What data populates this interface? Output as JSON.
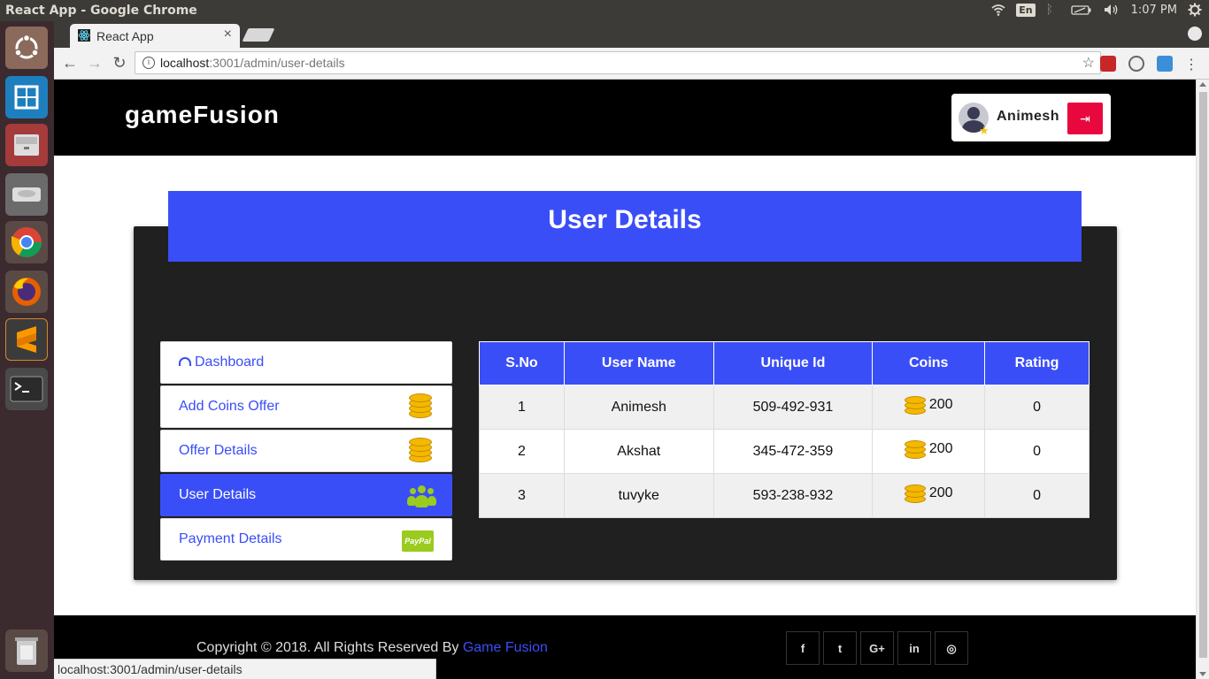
{
  "os": {
    "window_title": "React App - Google Chrome",
    "lang": "En",
    "clock": "1:07 PM"
  },
  "browser": {
    "tab_title": "React App",
    "tab_close": "×",
    "url_host": "localhost",
    "url_rest": ":3001/admin/user-details",
    "back": "←",
    "forward": "→",
    "reload": "↻",
    "star": "☆",
    "menu": "⋮",
    "info": "i",
    "status_url": "localhost:3001/admin/user-details"
  },
  "site": {
    "brand": "gameFusion",
    "user_name": "Animesh",
    "logout_icon": "⇥",
    "page_title": "User Details"
  },
  "sidebar": {
    "items": [
      {
        "label": "Dashboard",
        "icon": "dashboard-icon"
      },
      {
        "label": "Add Coins Offer",
        "icon": "coins-icon"
      },
      {
        "label": "Offer Details",
        "icon": "coins-icon"
      },
      {
        "label": "User Details",
        "icon": "users-icon"
      },
      {
        "label": "Payment Details",
        "icon": "paypal-icon"
      }
    ],
    "paypal_text": "PayPal"
  },
  "table": {
    "headers": [
      "S.No",
      "User Name",
      "Unique Id",
      "Coins",
      "Rating"
    ],
    "rows": [
      [
        "1",
        "Animesh",
        "509-492-931",
        "200",
        "0"
      ],
      [
        "2",
        "Akshat",
        "345-472-359",
        "200",
        "0"
      ],
      [
        "3",
        "tuvyke",
        "593-238-932",
        "200",
        "0"
      ]
    ]
  },
  "footer": {
    "copyright": "Copyright © 2018. All Rights Reserved By ",
    "link": "Game Fusion",
    "socials": [
      "f",
      "t",
      "G+",
      "in",
      "◎"
    ]
  },
  "colors": {
    "accent": "#3a4ef7",
    "logout": "#e8083e",
    "green_icon": "#9acb1e",
    "coin": "#f3b800"
  }
}
